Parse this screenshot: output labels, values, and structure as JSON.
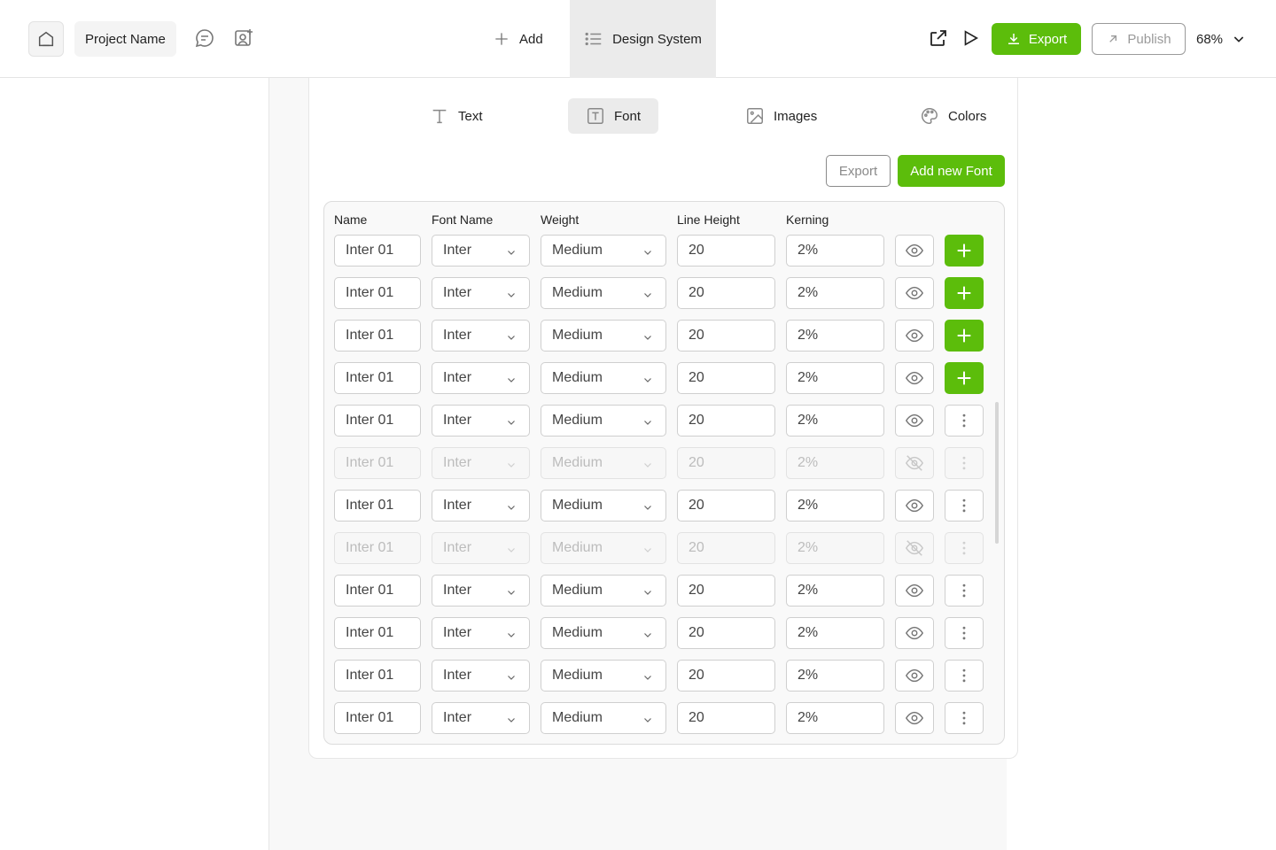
{
  "header": {
    "project_name": "Project Name",
    "add_label": "Add",
    "design_system_label": "Design System",
    "export_label": "Export",
    "publish_label": "Publish",
    "zoom": "68%"
  },
  "tabs": [
    {
      "label": "Text",
      "icon": "text-icon"
    },
    {
      "label": "Font",
      "icon": "font-icon",
      "active": true
    },
    {
      "label": "Images",
      "icon": "image-icon"
    },
    {
      "label": "Colors",
      "icon": "palette-icon"
    }
  ],
  "actions": {
    "export_label": "Export",
    "add_font_label": "Add new Font"
  },
  "table": {
    "headers": [
      "Name",
      "Font Name",
      "Weight",
      "Line Height",
      "Kerning"
    ],
    "rows": [
      {
        "name": "Inter 01",
        "font": "Inter",
        "weight": "Medium",
        "line_height": "20",
        "kerning": "2%",
        "visible": true,
        "action": "add"
      },
      {
        "name": "Inter 01",
        "font": "Inter",
        "weight": "Medium",
        "line_height": "20",
        "kerning": "2%",
        "visible": true,
        "action": "add"
      },
      {
        "name": "Inter 01",
        "font": "Inter",
        "weight": "Medium",
        "line_height": "20",
        "kerning": "2%",
        "visible": true,
        "action": "add"
      },
      {
        "name": "Inter 01",
        "font": "Inter",
        "weight": "Medium",
        "line_height": "20",
        "kerning": "2%",
        "visible": true,
        "action": "add"
      },
      {
        "name": "Inter 01",
        "font": "Inter",
        "weight": "Medium",
        "line_height": "20",
        "kerning": "2%",
        "visible": true,
        "action": "more"
      },
      {
        "name": "Inter 01",
        "font": "Inter",
        "weight": "Medium",
        "line_height": "20",
        "kerning": "2%",
        "visible": false,
        "action": "more"
      },
      {
        "name": "Inter 01",
        "font": "Inter",
        "weight": "Medium",
        "line_height": "20",
        "kerning": "2%",
        "visible": true,
        "action": "more"
      },
      {
        "name": "Inter 01",
        "font": "Inter",
        "weight": "Medium",
        "line_height": "20",
        "kerning": "2%",
        "visible": false,
        "action": "more"
      },
      {
        "name": "Inter 01",
        "font": "Inter",
        "weight": "Medium",
        "line_height": "20",
        "kerning": "2%",
        "visible": true,
        "action": "more"
      },
      {
        "name": "Inter 01",
        "font": "Inter",
        "weight": "Medium",
        "line_height": "20",
        "kerning": "2%",
        "visible": true,
        "action": "more"
      },
      {
        "name": "Inter 01",
        "font": "Inter",
        "weight": "Medium",
        "line_height": "20",
        "kerning": "2%",
        "visible": true,
        "action": "more"
      },
      {
        "name": "Inter 01",
        "font": "Inter",
        "weight": "Medium",
        "line_height": "20",
        "kerning": "2%",
        "visible": true,
        "action": "more"
      }
    ]
  },
  "colors": {
    "accent": "#5cbd0b",
    "muted": "#8a8a8a"
  }
}
